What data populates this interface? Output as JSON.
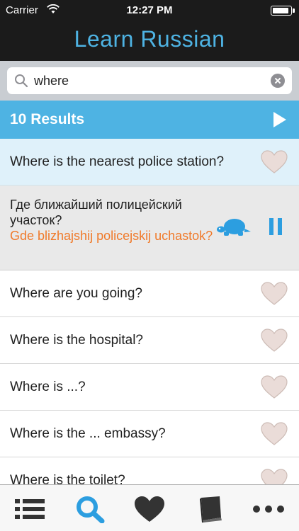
{
  "status_bar": {
    "carrier": "Carrier",
    "time": "12:27 PM",
    "battery_level": 0.95
  },
  "header": {
    "title": "Learn Russian"
  },
  "search": {
    "value": "where",
    "placeholder": ""
  },
  "results": {
    "label": "10 Results"
  },
  "list": {
    "first": "Where is the nearest police station?",
    "expanded": {
      "russian": "Где ближайший полицейский участок?",
      "transliteration": "Gde blizhajshij policejskij uchastok?"
    },
    "items": [
      "Where are you going?",
      "Where is the hospital?",
      "Where is ...?",
      "Where is the ... embassy?",
      "Where is the toilet?"
    ]
  },
  "colors": {
    "accent": "#4eb3e3",
    "header_bg": "#1b1b1b",
    "transliteration": "#f07a2a",
    "highlight_row": "#dff1fa",
    "expanded_row": "#e9e9e9",
    "tab_active": "#2c9ee0",
    "tab_inactive": "#333333"
  },
  "icons": {
    "tabs": [
      "list-icon",
      "search-icon",
      "heart-icon",
      "book-icon",
      "more-icon"
    ],
    "active_tab": "search-icon"
  }
}
